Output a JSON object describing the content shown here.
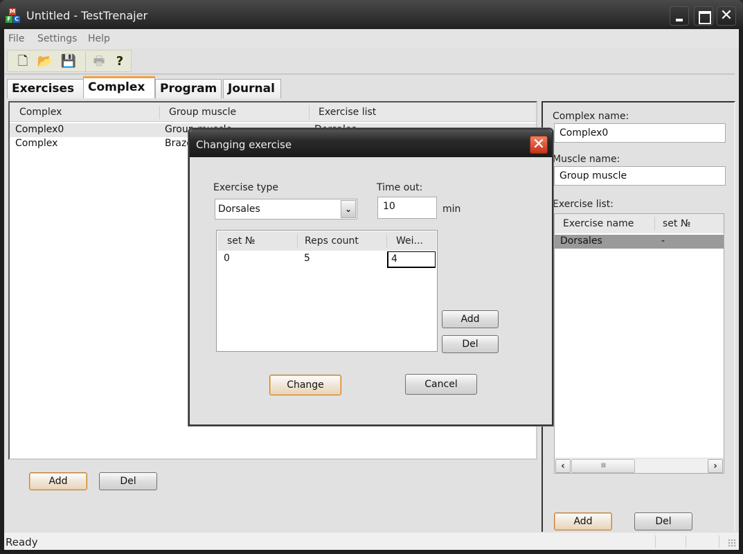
{
  "window": {
    "title": "Untitled - TestTrenajer",
    "controls": {
      "minimize": "_",
      "maximize": "□",
      "close": "✕"
    }
  },
  "menu": [
    "File",
    "Settings",
    "Help"
  ],
  "toolbar": {
    "icons": [
      {
        "name": "new-icon",
        "glyph": "🗋"
      },
      {
        "name": "open-icon",
        "glyph": "📂"
      },
      {
        "name": "save-icon",
        "glyph": "💾"
      },
      {
        "name": "print-icon",
        "glyph": "🖶"
      },
      {
        "name": "help-icon",
        "glyph": "?"
      }
    ]
  },
  "tabs": [
    {
      "label": "Exercises",
      "active": false
    },
    {
      "label": "Complex",
      "active": true
    },
    {
      "label": "Program",
      "active": false
    },
    {
      "label": "Journal",
      "active": false
    }
  ],
  "complex_list": {
    "columns": [
      "Complex",
      "Group muscle",
      "Exercise list"
    ],
    "rows": [
      {
        "complex": "Complex0",
        "group": "Group muscle",
        "exercises": "Dorsales",
        "selected": true
      },
      {
        "complex": "Complex",
        "group": "Brazo",
        "exercises": "",
        "selected": false
      }
    ],
    "add_label": "Add",
    "del_label": "Del"
  },
  "details": {
    "complex_name_label": "Complex name:",
    "complex_name_value": "Complex0",
    "muscle_name_label": "Muscle name:",
    "muscle_name_value": "Group muscle",
    "exercise_list_label": "Exercise list:",
    "exercise_columns": [
      "Exercise name",
      "set №"
    ],
    "exercise_rows": [
      {
        "name": "Dorsales",
        "set": "-"
      }
    ],
    "scroll_thumb": "IIII",
    "add_label": "Add",
    "del_label": "Del"
  },
  "status": {
    "text": "Ready"
  },
  "dialog": {
    "title": "Changing exercise",
    "close": "✕",
    "exercise_type_label": "Exercise type",
    "exercise_type_value": "Dorsales",
    "timeout_label": "Time out:",
    "timeout_value": "10",
    "timeout_unit": "min",
    "sets_columns": [
      "set №",
      "Reps count",
      "Wei..."
    ],
    "sets_rows": [
      {
        "set": "0",
        "reps": "5",
        "weight": "4"
      }
    ],
    "add_label": "Add",
    "del_label": "Del",
    "change_label": "Change",
    "cancel_label": "Cancel"
  }
}
